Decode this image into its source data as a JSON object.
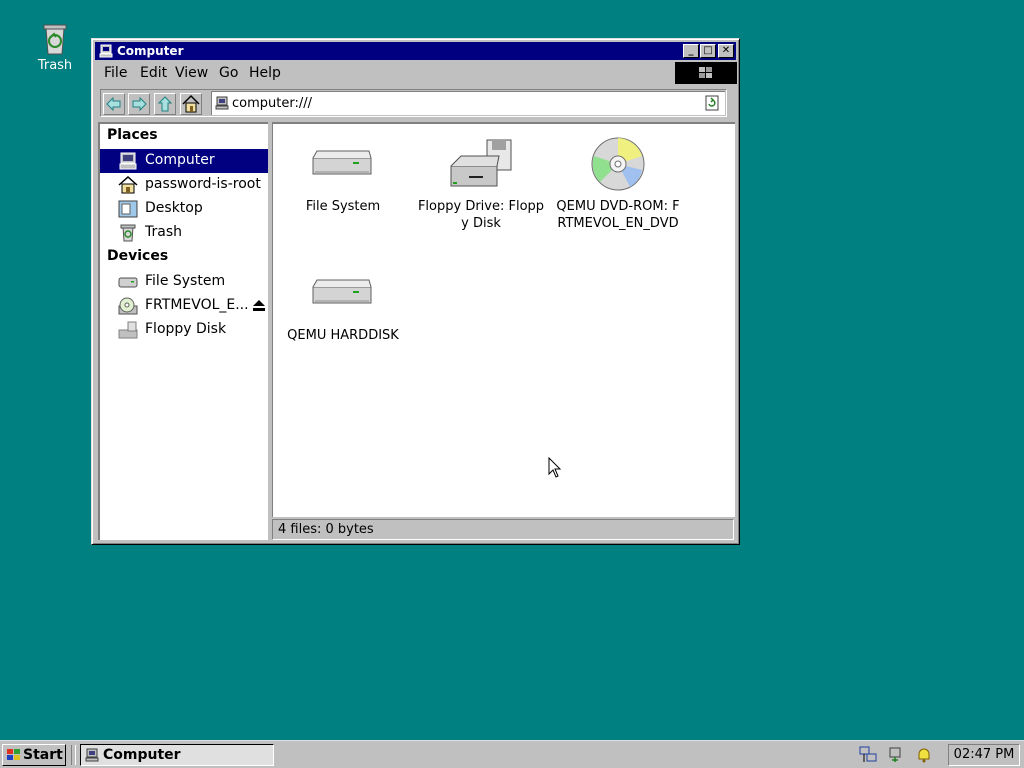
{
  "desktop": {
    "trash_label": "Trash"
  },
  "window": {
    "title": "Computer",
    "menu": [
      "File",
      "Edit",
      "View",
      "Go",
      "Help"
    ],
    "address": "computer:///",
    "sidebar": {
      "places_header": "Places",
      "places": [
        {
          "label": "Computer",
          "icon": "computer-icon",
          "selected": true
        },
        {
          "label": "password-is-root",
          "icon": "home-icon"
        },
        {
          "label": "Desktop",
          "icon": "desktop-icon"
        },
        {
          "label": "Trash",
          "icon": "trash-icon"
        }
      ],
      "devices_header": "Devices",
      "devices": [
        {
          "label": "File System",
          "icon": "harddisk-icon"
        },
        {
          "label": "FRTMEVOL_E...",
          "icon": "cdrom-icon"
        },
        {
          "label": "Floppy Disk",
          "icon": "floppy-icon"
        }
      ]
    },
    "files": [
      {
        "label": "File System",
        "icon": "harddisk-icon"
      },
      {
        "label": "Floppy Drive: Floppy Disk",
        "icon": "floppy-drive-icon"
      },
      {
        "label": "QEMU DVD-ROM: FRTMEVOL_EN_DVD",
        "icon": "dvd-icon"
      },
      {
        "label": "QEMU HARDDISK",
        "icon": "harddisk-icon"
      }
    ],
    "status": "4 files: 0 bytes"
  },
  "taskbar": {
    "start_label": "Start",
    "task_label": "Computer",
    "clock": "02:47 PM"
  },
  "colors": {
    "desktop": "#008080",
    "titlebar": "#000080",
    "face": "#c0c0c0"
  }
}
